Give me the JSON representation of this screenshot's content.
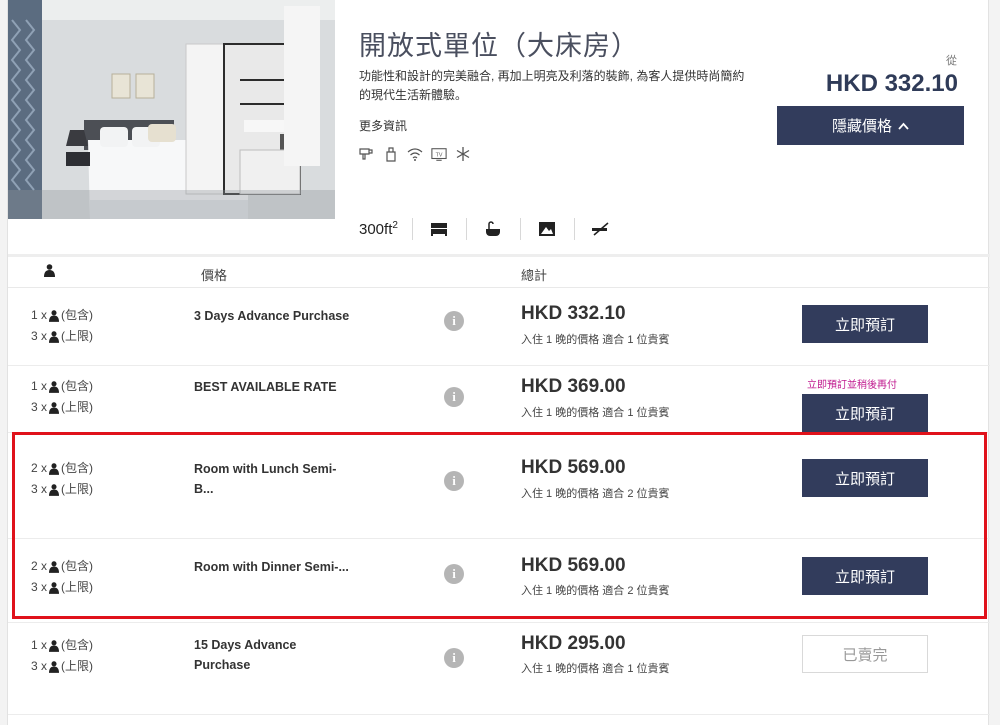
{
  "room": {
    "title": "開放式單位（大床房）",
    "description": "功能性和設計的完美融合, 再加上明亮及利落的裝飾, 為客人提供時尚簡約的現代生活新體驗。",
    "more_info": "更多資訊",
    "amenities": [
      "hairdryer-icon",
      "toiletries-icon",
      "wifi-icon",
      "tv-icon",
      "air-conditioning-icon"
    ],
    "size": "300ft",
    "size_sup": "2",
    "features": [
      "bed-icon",
      "bathroom-icon",
      "window-view-icon",
      "no-smoking-icon"
    ]
  },
  "pricing": {
    "from_label": "從",
    "from_price": "HKD 332.10",
    "hide_button": "隱藏價格"
  },
  "table_headers": {
    "price": "價格",
    "total": "總計"
  },
  "rates": [
    {
      "included": "1 x",
      "included_label": "(包含)",
      "max": "3 x",
      "max_label": "(上限)",
      "name_line1": "3 Days Advance Purchase",
      "name_line2": "",
      "price": "HKD 332.10",
      "subtitle": "入住 1 晚的價格 適合 1 位貴賓",
      "note": "",
      "button": "立即預訂",
      "sold_out": false
    },
    {
      "included": "1 x",
      "included_label": "(包含)",
      "max": "3 x",
      "max_label": "(上限)",
      "name_line1": "BEST AVAILABLE RATE",
      "name_line2": "",
      "price": "HKD 369.00",
      "subtitle": "入住 1 晚的價格 適合 1 位貴賓",
      "note": "立即預訂並稍後再付",
      "button": "立即預訂",
      "sold_out": false
    },
    {
      "included": "2 x",
      "included_label": "(包含)",
      "max": "3 x",
      "max_label": "(上限)",
      "name_line1": "Room with Lunch Semi-",
      "name_line2": "B...",
      "price": "HKD 569.00",
      "subtitle": "入住 1 晚的價格 適合 2 位貴賓",
      "note": "",
      "button": "立即預訂",
      "sold_out": false
    },
    {
      "included": "2 x",
      "included_label": "(包含)",
      "max": "3 x",
      "max_label": "(上限)",
      "name_line1": "Room with Dinner Semi-...",
      "name_line2": "",
      "price": "HKD 569.00",
      "subtitle": "入住 1 晚的價格 適合 2 位貴賓",
      "note": "",
      "button": "立即預訂",
      "sold_out": false
    },
    {
      "included": "1 x",
      "included_label": "(包含)",
      "max": "3 x",
      "max_label": "(上限)",
      "name_line1": "15 Days Advance",
      "name_line2": "Purchase",
      "price": "HKD 295.00",
      "subtitle": "入住 1 晚的價格 適合 1 位貴賓",
      "note": "",
      "button": "已賣完",
      "sold_out": true
    }
  ],
  "colors": {
    "primary_button": "#323c5c",
    "highlight_border": "#e0121b",
    "note_text": "#c0198f"
  }
}
